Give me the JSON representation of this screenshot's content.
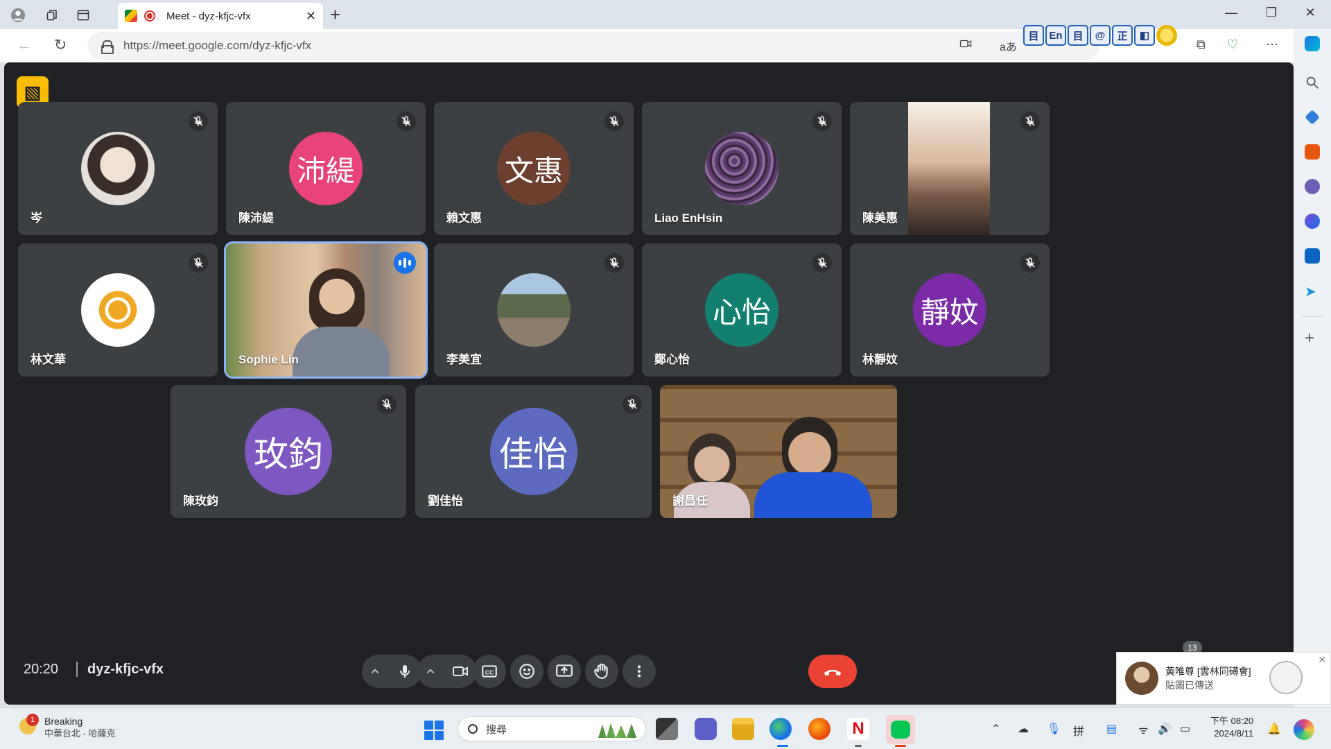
{
  "browser": {
    "tab_title": "Meet - dyz-kfjc-vfx",
    "url": "https://meet.google.com/dyz-kfjc-vfx",
    "extensions": [
      "目",
      "En",
      "目",
      "@",
      "正",
      "◧",
      ""
    ]
  },
  "meet": {
    "time": "20:20",
    "meeting_code": "dyz-kfjc-vfx",
    "participants": [
      {
        "name": "岑",
        "avatar_text": "",
        "avatar_color": "#d9d4cf",
        "muted": true
      },
      {
        "name": "陳沛緹",
        "avatar_text": "沛緹",
        "avatar_color": "#e8437a",
        "muted": true
      },
      {
        "name": "賴文惠",
        "avatar_text": "文惠",
        "avatar_color": "#6d3f2f",
        "muted": true
      },
      {
        "name": "Liao EnHsin",
        "avatar_text": "",
        "avatar_color": "#5b3b6b",
        "muted": true
      },
      {
        "name": "陳美惠",
        "avatar_text": "",
        "avatar_color": "#cfa88b",
        "muted": true
      },
      {
        "name": "林文華",
        "avatar_text": "",
        "avatar_color": "#ffffff",
        "muted": true
      },
      {
        "name": "Sophie Lin",
        "avatar_text": "",
        "avatar_color": "#c99a72",
        "muted": false,
        "speaking": true
      },
      {
        "name": "李美宜",
        "avatar_text": "",
        "avatar_color": "#7a8a66",
        "muted": true
      },
      {
        "name": "鄭心怡",
        "avatar_text": "心怡",
        "avatar_color": "#128070",
        "muted": true
      },
      {
        "name": "林靜妏",
        "avatar_text": "靜妏",
        "avatar_color": "#7b2aa8",
        "muted": true
      },
      {
        "name": "陳玫鈞",
        "avatar_text": "玫鈞",
        "avatar_color": "#7e57c2",
        "muted": true
      },
      {
        "name": "劉佳怡",
        "avatar_text": "佳怡",
        "avatar_color": "#5c6bc0",
        "muted": true
      },
      {
        "name": "謝昌任",
        "avatar_text": "",
        "avatar_color": "#7a5a3a",
        "muted": false
      }
    ],
    "controls": [
      "mic",
      "camera",
      "captions",
      "emoji",
      "present",
      "raise-hand",
      "more",
      "leave-call"
    ]
  },
  "toast": {
    "badge": "13",
    "sender": "黃唯尊 [雲林同礡會]",
    "message": "貼圖已傳送"
  },
  "taskbar": {
    "weather_badge": "1",
    "weather_title": "Breaking",
    "weather_sub": "中華台北 - 哈薩克",
    "search_placeholder": "搜尋",
    "clock_time": "下午 08:20",
    "clock_date": "2024/8/11"
  }
}
